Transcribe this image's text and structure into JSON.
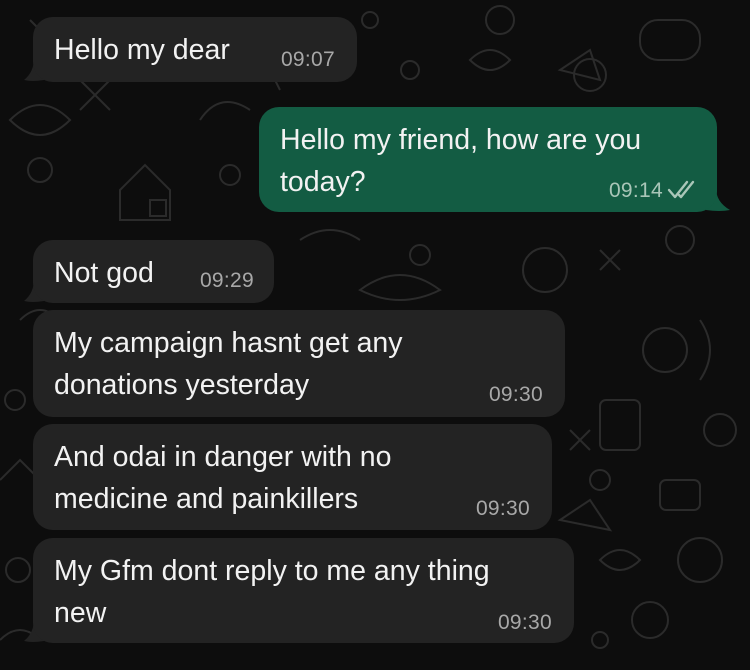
{
  "chat": {
    "messages": [
      {
        "direction": "incoming",
        "text": "Hello my dear",
        "time": "09:07"
      },
      {
        "direction": "outgoing",
        "text": "Hello my friend, how are you\ntoday?",
        "time": "09:14",
        "status_icon": "double-check-read-icon"
      },
      {
        "direction": "incoming",
        "text": "Not god",
        "time": "09:29"
      },
      {
        "direction": "incoming",
        "text": "My campaign hasnt get any\ndonations yesterday",
        "time": "09:30"
      },
      {
        "direction": "incoming",
        "text": "And odai in danger with no\nmedicine and painkillers",
        "time": "09:30"
      },
      {
        "direction": "incoming",
        "text": "My Gfm dont reply to me any thing\nnew",
        "time": "09:30"
      }
    ]
  },
  "colors": {
    "background": "#0d0d0d",
    "incoming_bubble": "#232323",
    "outgoing_bubble": "#135c43",
    "text": "#f2f2f2",
    "timestamp": "#a8a8a8"
  }
}
